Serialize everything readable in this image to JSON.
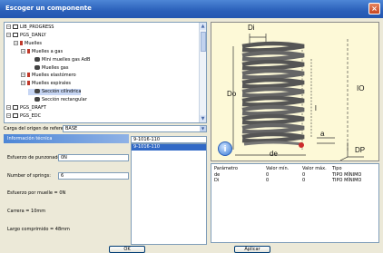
{
  "window": {
    "title": "Escoger un componente",
    "close": "×"
  },
  "tree": {
    "nodes": [
      {
        "label": "LIB_PROGRESS",
        "indent": 1,
        "icon": "doc"
      },
      {
        "label": "PGS_DANLY",
        "indent": 1,
        "icon": "doc"
      },
      {
        "label": "Muelles",
        "indent": 2,
        "icon": "folder"
      },
      {
        "label": "Muelles a gas",
        "indent": 3,
        "icon": "folder"
      },
      {
        "label": "Mini muelles gas AdB",
        "indent": 4,
        "icon": "spring"
      },
      {
        "label": "Muelles gas",
        "indent": 4,
        "icon": "spring"
      },
      {
        "label": "Muelles elastómero",
        "indent": 3,
        "icon": "folder"
      },
      {
        "label": "Muelles espirales",
        "indent": 3,
        "icon": "folder"
      },
      {
        "label": "Sección cilíndrica",
        "indent": 4,
        "icon": "spring",
        "selected": true
      },
      {
        "label": "Sección rectangular",
        "indent": 4,
        "icon": "spring"
      },
      {
        "label": "PGS_DRAFT",
        "indent": 1,
        "icon": "doc"
      },
      {
        "label": "PGS_EDC",
        "indent": 1,
        "icon": "doc"
      }
    ]
  },
  "reference": {
    "label": "Carga del origen de referencia:",
    "value": "BASE"
  },
  "info": {
    "header": "Información técnica",
    "fields": [
      {
        "label": "Esfuerzo de punzonado:",
        "value": "0N"
      },
      {
        "label": "Number of springs:",
        "value": "6"
      }
    ],
    "statics": [
      "Esfuerzo por muelle = 0N",
      "Carrera = 10mm",
      "Largo comprimido = 48mm"
    ]
  },
  "code_list": {
    "header": "9-1016-110",
    "items": [
      "9-1016-110"
    ]
  },
  "drawing": {
    "labels": {
      "di": "Di",
      "do": "Do",
      "io": "IO",
      "l": "l",
      "a": "a",
      "de": "de",
      "dp": "DP"
    }
  },
  "param_table": {
    "columns": [
      "Parámetro",
      "Valor mín.",
      "Valor máx.",
      "Tipo"
    ],
    "rows": [
      [
        "de",
        "0",
        "0",
        "TIPO MÍNIMO"
      ],
      [
        "Di",
        "0",
        "0",
        "TIPO MÍNIMO"
      ]
    ]
  },
  "buttons": {
    "ok": "OK",
    "apply": "Aplicar"
  }
}
